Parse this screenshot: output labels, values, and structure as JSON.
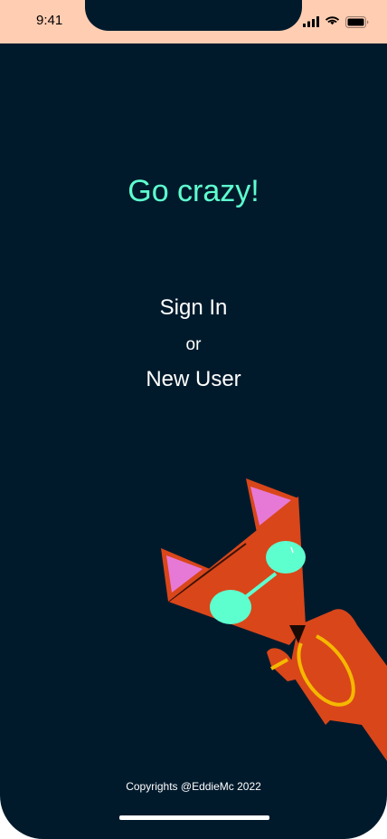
{
  "status_bar": {
    "time": "9:41",
    "icons": [
      "cellular-signal-icon",
      "wifi-icon",
      "battery-icon"
    ]
  },
  "main": {
    "headline": "Go crazy!",
    "sign_in_label": "Sign In",
    "separator": "or",
    "new_user_label": "New User"
  },
  "illustration": {
    "name": "fox-mascot-illustration",
    "colors": {
      "body": "#d9461a",
      "ears": "#e779d6",
      "glasses": "#5effcf",
      "necklace": "#f5b800"
    }
  },
  "footer": {
    "copyright": "Copyrights @EddieMc 2022"
  },
  "colors": {
    "background": "#001a2c",
    "status_bar": "#ffcdb2",
    "accent": "#5effcf",
    "text": "#ffffff"
  }
}
